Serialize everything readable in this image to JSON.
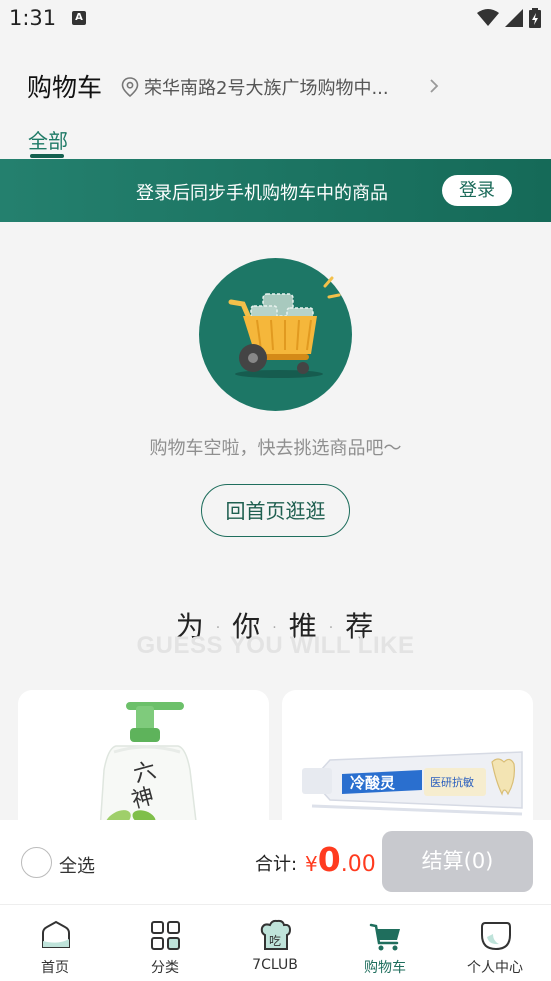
{
  "status_bar": {
    "time": "1:31",
    "icons": [
      "a-notification-icon",
      "wifi-icon",
      "signal-icon",
      "battery-icon"
    ]
  },
  "header": {
    "title": "购物车",
    "location": "荣华南路2号大族广场购物中...",
    "tab": "全部"
  },
  "login_banner": {
    "message": "登录后同步手机购物车中的商品",
    "button_label": "登录"
  },
  "empty_state": {
    "message": "购物车空啦，快去挑选商品吧～",
    "button_label": "回首页逛逛"
  },
  "recommend": {
    "title_chars": [
      "为",
      "你",
      "推",
      "荐"
    ],
    "subtitle": "GUESS YOU WILL LIKE"
  },
  "cart_bar": {
    "select_all_label": "全选",
    "total_label": "合计:",
    "currency": "¥",
    "amount_int": "0",
    "amount_dec": ".00",
    "checkout_label": "结算(0)"
  },
  "bottom_nav": {
    "items": [
      {
        "label": "首页",
        "icon": "home-icon"
      },
      {
        "label": "分类",
        "icon": "category-icon"
      },
      {
        "label": "7CLUB",
        "icon": "7club-icon"
      },
      {
        "label": "购物车",
        "icon": "cart-icon",
        "active": true
      },
      {
        "label": "个人中心",
        "icon": "profile-icon"
      }
    ]
  },
  "colors": {
    "brand_green": "#1f6e5d",
    "price_red": "#ff3b1f",
    "checkout_disabled": "#c8c9ce"
  }
}
